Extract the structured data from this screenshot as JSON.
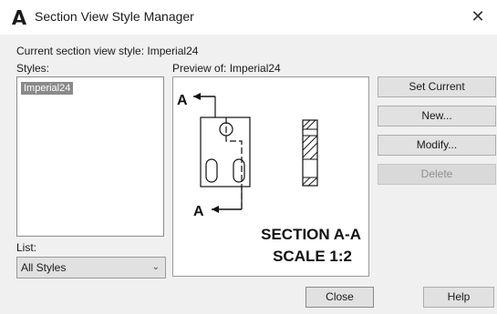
{
  "window": {
    "title": "Section View Style Manager",
    "close_glyph": "✕",
    "icon": "autocad-icon"
  },
  "current_style": {
    "label": "Current section view style: Imperial24"
  },
  "styles": {
    "label": "Styles:",
    "items": [
      "Imperial24"
    ],
    "selected": "Imperial24"
  },
  "list": {
    "label": "List:",
    "value": "All Styles"
  },
  "preview": {
    "label": "Preview of: Imperial24",
    "marker_top": "A",
    "marker_bottom": "A",
    "caption_line1": "SECTION A-A",
    "caption_line2": "SCALE 1:2"
  },
  "buttons": {
    "set_current": "Set Current",
    "new": "New...",
    "modify": "Modify...",
    "delete": "Delete",
    "close": "Close",
    "help": "Help"
  },
  "colors": {
    "selection_bg": "#8a8a8a",
    "dialog_bg": "#f0f0f0"
  }
}
